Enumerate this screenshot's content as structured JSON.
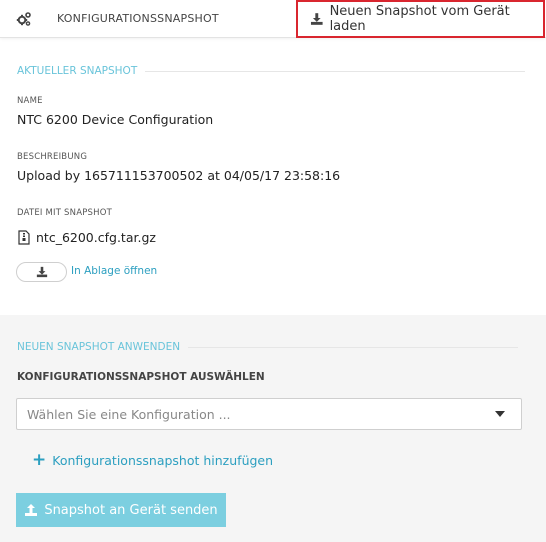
{
  "header": {
    "icon": "gears-icon",
    "title": "KONFIGURATIONSSNAPSHOT",
    "load_button_icon": "download-icon",
    "load_button_label": "Neuen Snapshot vom Gerät laden",
    "highlight_color": "#d9262f"
  },
  "current": {
    "section_title": "AKTUELLER SNAPSHOT",
    "name_label": "NAME",
    "name_value": "NTC 6200 Device Configuration",
    "description_label": "BESCHREIBUNG",
    "description_value": "Upload by 165711153700502 at 04/05/17 23:58:16",
    "file_label": "DATEI MIT SNAPSHOT",
    "file_icon": "archive-file-icon",
    "file_name": "ntc_6200.cfg.tar.gz",
    "download_icon": "download-icon",
    "open_link_label": "In Ablage öffnen"
  },
  "apply": {
    "section_title": "NEUEN SNAPSHOT ANWENDEN",
    "select_label": "KONFIGURATIONSSNAPSHOT AUSWÄHLEN",
    "select_placeholder": "Wählen Sie eine Konfiguration ...",
    "add_link_label": "Konfigurationssnapshot hinzufügen",
    "send_button_icon": "upload-icon",
    "send_button_label": "Snapshot an Gerät senden",
    "accent_color": "#69c4da",
    "link_color": "#2c9fc0",
    "send_button_color": "#7ccfe0"
  }
}
